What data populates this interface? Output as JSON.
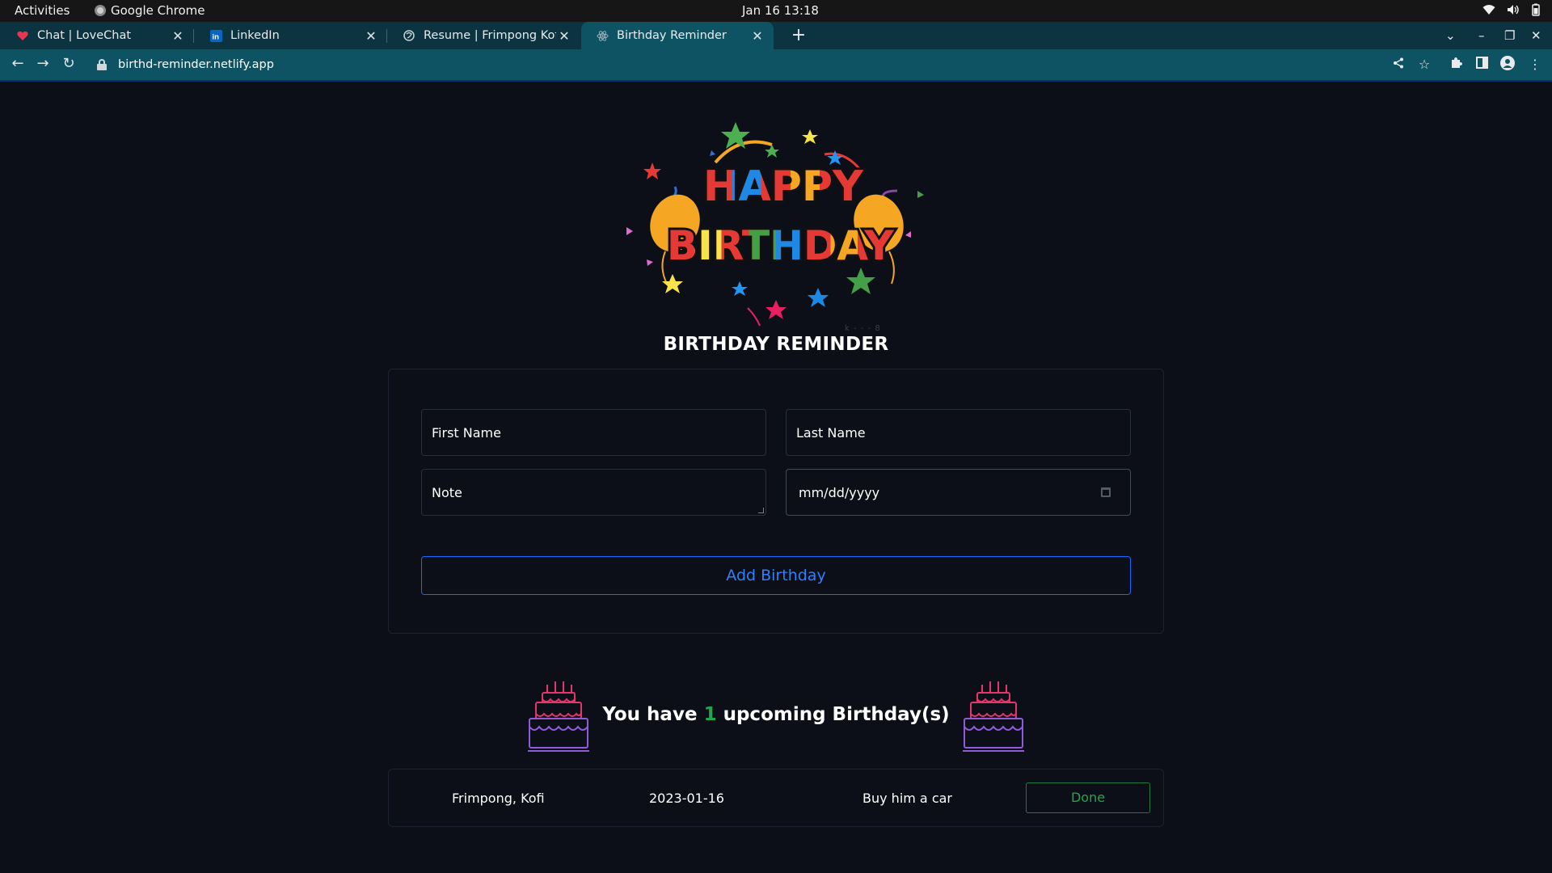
{
  "system_bar": {
    "activities": "Activities",
    "app_name": "Google Chrome",
    "clock": "Jan 16  13:18"
  },
  "browser": {
    "tabs": [
      {
        "title": "Chat | LoveChat",
        "favicon": "heart-icon",
        "active": false
      },
      {
        "title": "LinkedIn",
        "favicon": "linkedin-icon",
        "active": false
      },
      {
        "title": "Resume | Frimpong Kofi",
        "favicon": "globe-icon",
        "active": false
      },
      {
        "title": "Birthday Reminder",
        "favicon": "react-icon",
        "active": true
      }
    ],
    "url": "birthd-reminder.netlify.app"
  },
  "page": {
    "banner": {
      "line1": "HAPPY",
      "line2": "BIRTHDAY",
      "watermark": "k - - - 8"
    },
    "heading": "BIRTHDAY REMINDER",
    "form": {
      "first_name_placeholder": "First Name",
      "last_name_placeholder": "Last Name",
      "note_placeholder": "Note",
      "date_placeholder": "mm/dd/yyyy",
      "add_button": "Add Birthday"
    },
    "upcoming": {
      "prefix": "You have",
      "count": "1",
      "suffix": "upcoming Birthday(s)"
    },
    "birthdays": [
      {
        "name": "Frimpong, Kofi",
        "date": "2023-01-16",
        "note": "Buy him a car",
        "action": "Done"
      }
    ]
  },
  "colors": {
    "background": "#0c0f17",
    "primary": "#0d6efd",
    "success": "#22a54b",
    "tab_bar": "#0b3440",
    "toolbar": "#0e5363"
  }
}
